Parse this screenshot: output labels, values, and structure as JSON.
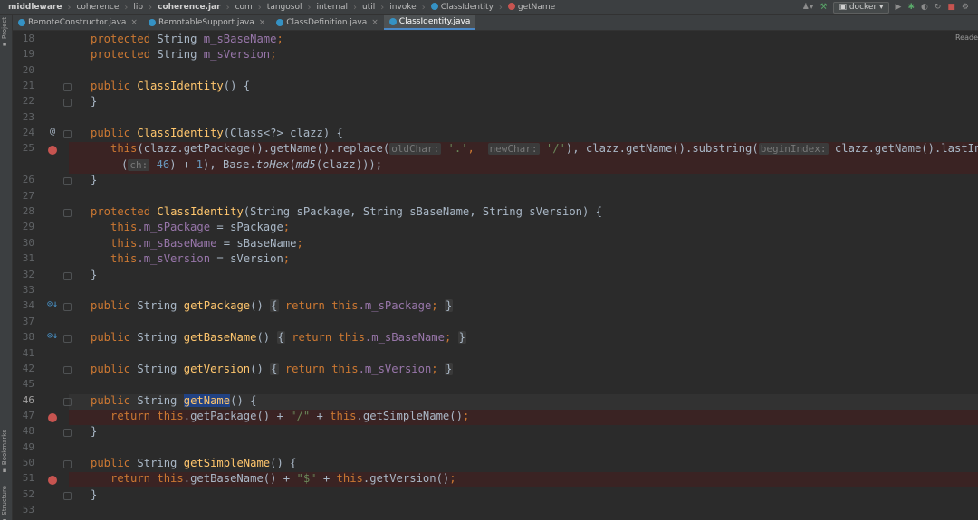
{
  "breadcrumbs": [
    "middleware",
    "coherence",
    "lib",
    "coherence.jar",
    "com",
    "tangosol",
    "internal",
    "util",
    "invoke",
    "ClassIdentity",
    "getName"
  ],
  "run_config": "docker",
  "tabs": [
    {
      "label": "RemoteConstructor.java"
    },
    {
      "label": "RemotableSupport.java"
    },
    {
      "label": "ClassDefinition.java"
    },
    {
      "label": "ClassIdentity.java"
    }
  ],
  "tool_windows": {
    "project": "Project",
    "bookmarks": "Bookmarks",
    "structure": "Structure"
  },
  "reader_mode": "Reade",
  "code": {
    "l18": {
      "num": "18",
      "kw": "protected",
      "t": "String",
      "fld": "m_sBaseName",
      "end": ";"
    },
    "l19": {
      "num": "19",
      "kw": "protected",
      "t": "String",
      "fld": "m_sVersion",
      "end": ";"
    },
    "l20": {
      "num": "20"
    },
    "l21": {
      "num": "21",
      "kw": "public",
      "name": "ClassIdentity",
      "rest": "() {"
    },
    "l22": {
      "num": "22",
      "text": "}"
    },
    "l23": {
      "num": "23"
    },
    "l24": {
      "num": "24",
      "kw": "public",
      "name": "ClassIdentity",
      "rest": "(Class<?> clazz) {"
    },
    "l25": {
      "num": "25",
      "kw": "this",
      "a": "(clazz.getPackage().getName().replace(",
      "h1": "oldChar:",
      "s1": "'.'",
      "c1": ",",
      "h2": "newChar:",
      "s2": "'/'",
      "b": "), clazz.getName().substring(",
      "h3": "beginIndex:",
      "c": "clazz.getName().lastIndexOf"
    },
    "l25b": {
      "p": "(",
      "h4": "ch:",
      "n1": "46",
      "m": ") + ",
      "n2": "1",
      "q": "), Base.",
      "f1": "toHex",
      "r": "(",
      "f2": "md5",
      "e": "(clazz)));"
    },
    "l26": {
      "num": "26",
      "text": "}"
    },
    "l27": {
      "num": "27"
    },
    "l28": {
      "num": "28",
      "kw": "protected",
      "name": "ClassIdentity",
      "rest": "(String sPackage, String sBaseName, String sVersion) {"
    },
    "l29": {
      "num": "29",
      "kw": "this",
      "fld": ".m_sPackage",
      "rest": " = sPackage",
      "end": ";"
    },
    "l30": {
      "num": "30",
      "kw": "this",
      "fld": ".m_sBaseName",
      "rest": " = sBaseName",
      "end": ";"
    },
    "l31": {
      "num": "31",
      "kw": "this",
      "fld": ".m_sVersion",
      "rest": " = sVersion",
      "end": ";"
    },
    "l32": {
      "num": "32",
      "text": "}"
    },
    "l33": {
      "num": "33"
    },
    "l34": {
      "num": "34",
      "kw": "public",
      "t": "String",
      "name": "getPackage",
      "par": "()",
      "ob": "{",
      "ret": "return",
      "th": "this",
      "fld": ".m_sPackage",
      "end": ";",
      "cb": "}"
    },
    "l37": {
      "num": "37"
    },
    "l38": {
      "num": "38",
      "kw": "public",
      "t": "String",
      "name": "getBaseName",
      "par": "()",
      "ob": "{",
      "ret": "return",
      "th": "this",
      "fld": ".m_sBaseName",
      "end": ";",
      "cb": "}"
    },
    "l41": {
      "num": "41"
    },
    "l42": {
      "num": "42",
      "kw": "public",
      "t": "String",
      "name": "getVersion",
      "par": "()",
      "ob": "{",
      "ret": "return",
      "th": "this",
      "fld": ".m_sVersion",
      "end": ";",
      "cb": "}"
    },
    "l45": {
      "num": "45"
    },
    "l46": {
      "num": "46",
      "kw": "public",
      "t": "String",
      "name": "getName",
      "rest": "() {"
    },
    "l47": {
      "num": "47",
      "ret": "return",
      "th": "this",
      "a": ".getPackage() + ",
      "s": "\"/\"",
      "b": " + ",
      "th2": "this",
      "c": ".getSimpleName()",
      "end": ";"
    },
    "l48": {
      "num": "48",
      "text": "}"
    },
    "l49": {
      "num": "49"
    },
    "l50": {
      "num": "50",
      "kw": "public",
      "t": "String",
      "name": "getSimpleName",
      "rest": "() {"
    },
    "l51": {
      "num": "51",
      "ret": "return",
      "th": "this",
      "a": ".getBaseName() + ",
      "s": "\"$\"",
      "b": " + ",
      "th2": "this",
      "c": ".getVersion()",
      "end": ";"
    },
    "l52": {
      "num": "52",
      "text": "}"
    },
    "l53": {
      "num": "53"
    }
  },
  "colors": {
    "keyword": "#cc7832",
    "method": "#ffc66d",
    "field": "#9876aa",
    "string": "#6a8759",
    "number": "#6897bb",
    "breakpoint": "#c75450"
  }
}
